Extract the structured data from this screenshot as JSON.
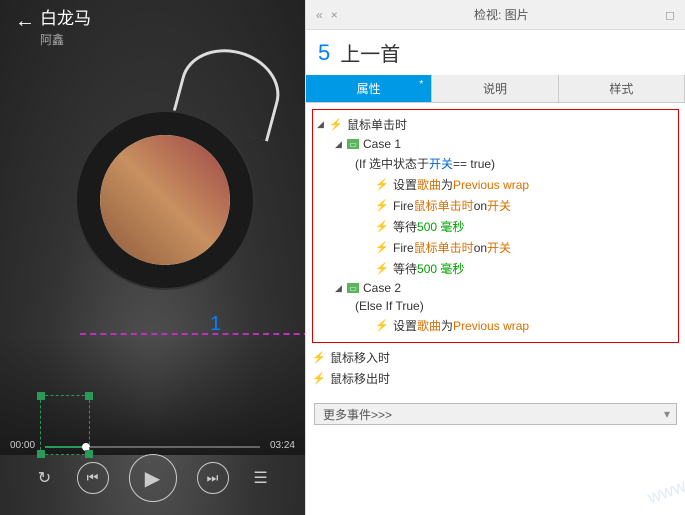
{
  "player": {
    "song_title": "白龙马",
    "artist": "阿鑫",
    "time_current": "00:00",
    "time_total": "03:24"
  },
  "annotations": {
    "step1": "1",
    "step5": "5"
  },
  "inspector": {
    "header_title": "检视: 图片",
    "element_name": "上一首",
    "tabs": {
      "properties": "属性",
      "notes": "说明",
      "style": "样式",
      "dirty": "*"
    },
    "tree": {
      "event_click": "鼠标单击时",
      "case1": "Case 1",
      "case1_cond_pre": "(If 选中状态于 ",
      "case1_cond_var": "开关",
      "case1_cond_post": " == true)",
      "act_set": "设置 ",
      "act_set_target": "歌曲",
      "act_set_mid": " 为 ",
      "act_set_val": "Previous wrap",
      "act_fire": "Fire ",
      "act_fire_event": "鼠标单击时",
      "act_fire_mid": " on ",
      "act_fire_target": "开关",
      "act_wait": "等待 ",
      "act_wait_val": "500 毫秒",
      "case2": "Case 2",
      "case2_cond": "(Else If True)",
      "event_mousein": "鼠标移入时",
      "event_mouseout": "鼠标移出时"
    },
    "more_events": "更多事件>>>"
  }
}
